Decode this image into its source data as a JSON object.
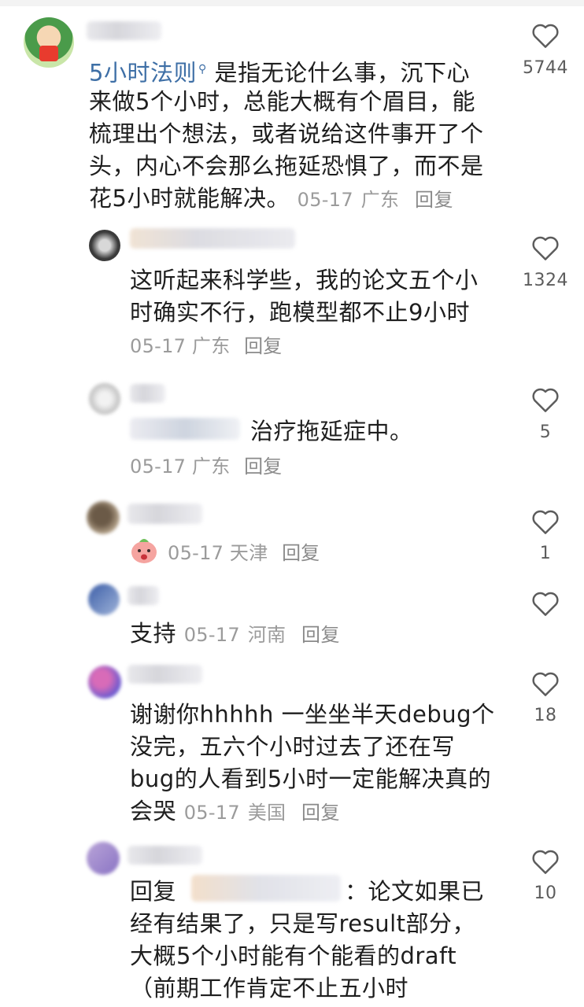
{
  "comments": [
    {
      "keyword": "5小时法则",
      "lines": [
        "是指无论什么事，沉下心",
        "来做5个小时，总能大概有个眉目，能",
        "梳理出个想法，或者说给这件事开了个",
        "头，内心不会那么拖延恐惧了，而不是",
        "花5小时就能解决。"
      ],
      "date": "05-17",
      "location": "广东",
      "reply_label": "回复",
      "likes": "5744"
    },
    {
      "lines": [
        "这听起来科学些，我的论文五个小",
        "时确实不行，跑模型都不止9小时"
      ],
      "date": "05-17",
      "location": "广东",
      "reply_label": "回复",
      "likes": "1324"
    },
    {
      "text": "治疗拖延症中。",
      "date": "05-17",
      "location": "广东",
      "reply_label": "回复",
      "likes": "5"
    },
    {
      "emoji": "peach-face-sticker",
      "date": "05-17",
      "location": "天津",
      "reply_label": "回复",
      "likes": "1"
    },
    {
      "text": "支持",
      "date": "05-17",
      "location": "河南",
      "reply_label": "回复",
      "likes": ""
    },
    {
      "lines": [
        "谢谢你hhhhh 一坐坐半天debug个",
        "没完，五六个小时过去了还在写",
        "bug的人看到5小时一定能解决真的",
        "会哭"
      ],
      "date": "05-17",
      "location": "美国",
      "reply_label": "回复",
      "likes": "18"
    },
    {
      "reply_prefix": "回复",
      "reply_suffix": "：论文如果已",
      "lines": [
        "经有结果了，只是写result部分，",
        "大概5个小时能有个能看的draft",
        "（前期工作肯定不止五小时"
      ],
      "likes": "10"
    }
  ],
  "colors": {
    "keyword": "#3e6fa6",
    "meta": "#9b9b9b",
    "text": "#1e1e1e",
    "heart": "#5c5c5c"
  }
}
